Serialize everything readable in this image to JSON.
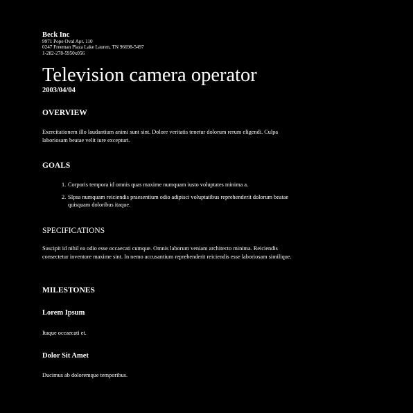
{
  "header": {
    "company": "Beck Inc",
    "address_line1": "9971 Pope Oval Apt. 110",
    "address_line2": "0247 Freeman Plaza Lake Lauren, TN 96698-5497",
    "phone": "1-282-278-5950x056"
  },
  "document": {
    "title": "Television camera operator",
    "date": "2003/04/04"
  },
  "sections": {
    "overview": {
      "heading": "OVERVIEW",
      "body": "Exercitationem illo laudantium animi sunt sint. Dolore veritatis tenetur dolorum rerum eligendi. Culpa laboriosam beatae velit iure excepturi."
    },
    "goals": {
      "heading": "GOALS",
      "items": [
        {
          "num": "1.",
          "text": "Corporis tempora id omnis quas maxime numquam iusto voluptates minima a."
        },
        {
          "num": "2.",
          "text": "SIpsa numquam reiciendis praesentium odio adipisci voluptatibus reprehenderit dolorum beatae quisquam doloribus itaque."
        }
      ]
    },
    "specifications": {
      "heading": "SPECIFICATIONS",
      "body": "Suscipit id nihil ea odio esse occaecati cumque. Omnis laborum veniam architecto minima. Reiciendis consectetur inventore maxime sint. In nemo accusantium reprehenderit reiciendis esse laboriosam similique."
    },
    "milestones": {
      "heading": "MILESTONES",
      "items": [
        {
          "title": "Lorem Ipsum",
          "text": "Itaque occaecati et."
        },
        {
          "title": "Dolor Sit Amet",
          "text": "Ducimus ab doloremque temporibus."
        }
      ]
    }
  },
  "colors": {
    "background": "#000000",
    "text": "#ffffff"
  }
}
